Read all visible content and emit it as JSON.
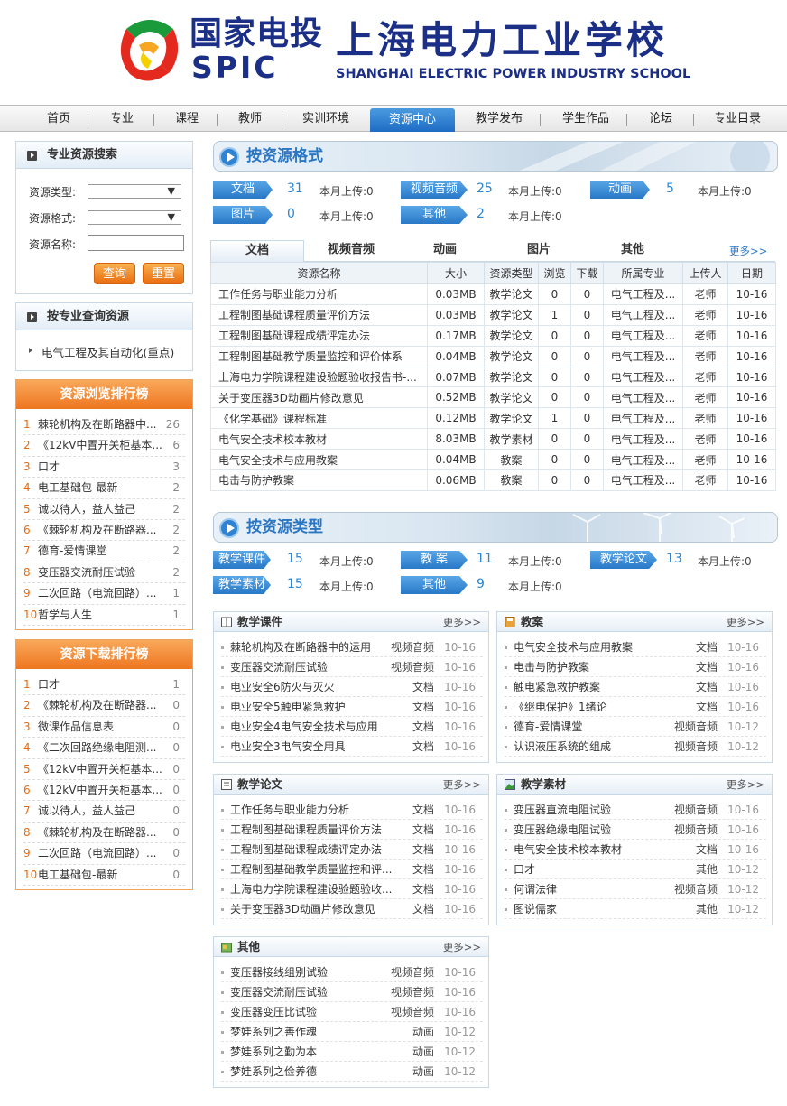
{
  "header": {
    "brand_cn": "国家电投",
    "brand_en": "SPIC",
    "school_cn": "上海电力工业学校",
    "school_en": "SHANGHAI ELECTRIC POWER INDUSTRY SCHOOL"
  },
  "nav": [
    "首页",
    "专业",
    "课程",
    "教师",
    "实训环境",
    "资源中心",
    "教学发布",
    "学生作品",
    "论坛",
    "专业目录"
  ],
  "nav_active": 5,
  "search": {
    "title": "专业资源搜索",
    "type_label": "资源类型:",
    "format_label": "资源格式:",
    "name_label": "资源名称:",
    "query_btn": "查询",
    "reset_btn": "重置"
  },
  "major": {
    "title": "按专业查询资源",
    "item": "电气工程及其自动化(重点)"
  },
  "browse_rank": {
    "title": "资源浏览排行榜",
    "items": [
      {
        "n": "1",
        "t": "棘轮机构及在断路器中...",
        "c": "26"
      },
      {
        "n": "2",
        "t": "《12kV中置开关柜基本...",
        "c": "6"
      },
      {
        "n": "3",
        "t": "口才",
        "c": "3"
      },
      {
        "n": "4",
        "t": "电工基础包-最新",
        "c": "2"
      },
      {
        "n": "5",
        "t": "诚以待人，益人益己",
        "c": "2"
      },
      {
        "n": "6",
        "t": "《棘轮机构及在断路器...",
        "c": "2"
      },
      {
        "n": "7",
        "t": "德育-爱情课堂",
        "c": "2"
      },
      {
        "n": "8",
        "t": "变压器交流耐压试验",
        "c": "2"
      },
      {
        "n": "9",
        "t": "二次回路（电流回路）...",
        "c": "1"
      },
      {
        "n": "10",
        "t": "哲学与人生",
        "c": "1"
      }
    ]
  },
  "download_rank": {
    "title": "资源下载排行榜",
    "items": [
      {
        "n": "1",
        "t": "口才",
        "c": "1"
      },
      {
        "n": "2",
        "t": "《棘轮机构及在断路器...",
        "c": "0"
      },
      {
        "n": "3",
        "t": "微课作品信息表",
        "c": "0"
      },
      {
        "n": "4",
        "t": "《二次回路绝缘电阻测...",
        "c": "0"
      },
      {
        "n": "5",
        "t": "《12kV中置开关柜基本...",
        "c": "0"
      },
      {
        "n": "6",
        "t": "《12kV中置开关柜基本...",
        "c": "0"
      },
      {
        "n": "7",
        "t": "诚以待人，益人益己",
        "c": "0"
      },
      {
        "n": "8",
        "t": "《棘轮机构及在断路器...",
        "c": "0"
      },
      {
        "n": "9",
        "t": "二次回路（电流回路）...",
        "c": "0"
      },
      {
        "n": "10",
        "t": "电工基础包-最新",
        "c": "0"
      }
    ]
  },
  "by_format": {
    "title": "按资源格式",
    "month_prefix": "本月上传:",
    "tags": [
      {
        "label": "文档",
        "count": "31",
        "month": "0"
      },
      {
        "label": "视频音频",
        "count": "25",
        "month": "0"
      },
      {
        "label": "动画",
        "count": "5",
        "month": "0"
      },
      {
        "label": "图片",
        "count": "0",
        "month": "0"
      },
      {
        "label": "其他",
        "count": "2",
        "month": "0"
      }
    ]
  },
  "tabs": [
    "文档",
    "视频音频",
    "动画",
    "图片",
    "其他"
  ],
  "more_label": "更多>>",
  "table": {
    "headers": [
      "资源名称",
      "大小",
      "资源类型",
      "浏览",
      "下载",
      "所属专业",
      "上传人",
      "日期"
    ],
    "rows": [
      [
        "工作任务与职业能力分析",
        "0.03MB",
        "教学论文",
        "0",
        "0",
        "电气工程及...",
        "老师",
        "10-16"
      ],
      [
        "工程制图基础课程质量评价方法",
        "0.03MB",
        "教学论文",
        "1",
        "0",
        "电气工程及...",
        "老师",
        "10-16"
      ],
      [
        "工程制图基础课程成绩评定办法",
        "0.17MB",
        "教学论文",
        "0",
        "0",
        "电气工程及...",
        "老师",
        "10-16"
      ],
      [
        "工程制图基础教学质量监控和评价体系",
        "0.04MB",
        "教学论文",
        "0",
        "0",
        "电气工程及...",
        "老师",
        "10-16"
      ],
      [
        "上海电力学院课程建设验题验收报告书-...",
        "0.07MB",
        "教学论文",
        "0",
        "0",
        "电气工程及...",
        "老师",
        "10-16"
      ],
      [
        "关于变压器3D动画片修改意见",
        "0.52MB",
        "教学论文",
        "0",
        "0",
        "电气工程及...",
        "老师",
        "10-16"
      ],
      [
        "《化学基础》课程标准",
        "0.12MB",
        "教学论文",
        "1",
        "0",
        "电气工程及...",
        "老师",
        "10-16"
      ],
      [
        "电气安全技术校本教材",
        "8.03MB",
        "教学素材",
        "0",
        "0",
        "电气工程及...",
        "老师",
        "10-16"
      ],
      [
        "电气安全技术与应用教案",
        "0.04MB",
        "教案",
        "0",
        "0",
        "电气工程及...",
        "老师",
        "10-16"
      ],
      [
        "电击与防护教案",
        "0.06MB",
        "教案",
        "0",
        "0",
        "电气工程及...",
        "老师",
        "10-16"
      ]
    ]
  },
  "by_type": {
    "title": "按资源类型",
    "month_prefix": "本月上传:",
    "tags": [
      {
        "label": "教学课件",
        "count": "15",
        "month": "0"
      },
      {
        "label": "教 案",
        "count": "11",
        "month": "0"
      },
      {
        "label": "教学论文",
        "count": "13",
        "month": "0"
      },
      {
        "label": "教学素材",
        "count": "15",
        "month": "0"
      },
      {
        "label": "其他",
        "count": "9",
        "month": "0"
      }
    ]
  },
  "panels": {
    "more": "更多>>",
    "kejian": {
      "title": "教学课件",
      "items": [
        [
          "棘轮机构及在断路器中的运用",
          "视频音频",
          "10-16"
        ],
        [
          "变压器交流耐压试验",
          "视频音频",
          "10-16"
        ],
        [
          "电业安全6防火与灭火",
          "文档",
          "10-16"
        ],
        [
          "电业安全5触电紧急救护",
          "文档",
          "10-16"
        ],
        [
          "电业安全4电气安全技术与应用",
          "文档",
          "10-16"
        ],
        [
          "电业安全3电气安全用具",
          "文档",
          "10-16"
        ]
      ]
    },
    "jiaoan": {
      "title": "教案",
      "items": [
        [
          "电气安全技术与应用教案",
          "文档",
          "10-16"
        ],
        [
          "电击与防护教案",
          "文档",
          "10-16"
        ],
        [
          "触电紧急救护教案",
          "文档",
          "10-16"
        ],
        [
          "《继电保护》1绪论",
          "文档",
          "10-16"
        ],
        [
          "德育-爱情课堂",
          "视频音频",
          "10-12"
        ],
        [
          "认识液压系统的组成",
          "视频音频",
          "10-12"
        ]
      ]
    },
    "lunwen": {
      "title": "教学论文",
      "items": [
        [
          "工作任务与职业能力分析",
          "文档",
          "10-16"
        ],
        [
          "工程制图基础课程质量评价方法",
          "文档",
          "10-16"
        ],
        [
          "工程制图基础课程成绩评定办法",
          "文档",
          "10-16"
        ],
        [
          "工程制图基础教学质量监控和评...",
          "文档",
          "10-16"
        ],
        [
          "上海电力学院课程建设验题验收...",
          "文档",
          "10-16"
        ],
        [
          "关于变压器3D动画片修改意见",
          "文档",
          "10-16"
        ]
      ]
    },
    "sucai": {
      "title": "教学素材",
      "items": [
        [
          "变压器直流电阻试验",
          "视频音频",
          "10-16"
        ],
        [
          "变压器绝缘电阻试验",
          "视频音频",
          "10-16"
        ],
        [
          "电气安全技术校本教材",
          "文档",
          "10-16"
        ],
        [
          "口才",
          "其他",
          "10-12"
        ],
        [
          "何谓法律",
          "视频音频",
          "10-12"
        ],
        [
          "图说儒家",
          "其他",
          "10-12"
        ]
      ]
    },
    "qita": {
      "title": "其他",
      "items": [
        [
          "变压器接线组别试验",
          "视频音频",
          "10-16"
        ],
        [
          "变压器交流耐压试验",
          "视频音频",
          "10-16"
        ],
        [
          "变压器变压比试验",
          "视频音频",
          "10-16"
        ],
        [
          "梦娃系列之善作魂",
          "动画",
          "10-12"
        ],
        [
          "梦娃系列之勤为本",
          "动画",
          "10-12"
        ],
        [
          "梦娃系列之俭养德",
          "动画",
          "10-12"
        ]
      ]
    }
  },
  "colors": {
    "brand": "#1c2f86",
    "accent": "#2a76c3",
    "orange": "#ee7620"
  }
}
